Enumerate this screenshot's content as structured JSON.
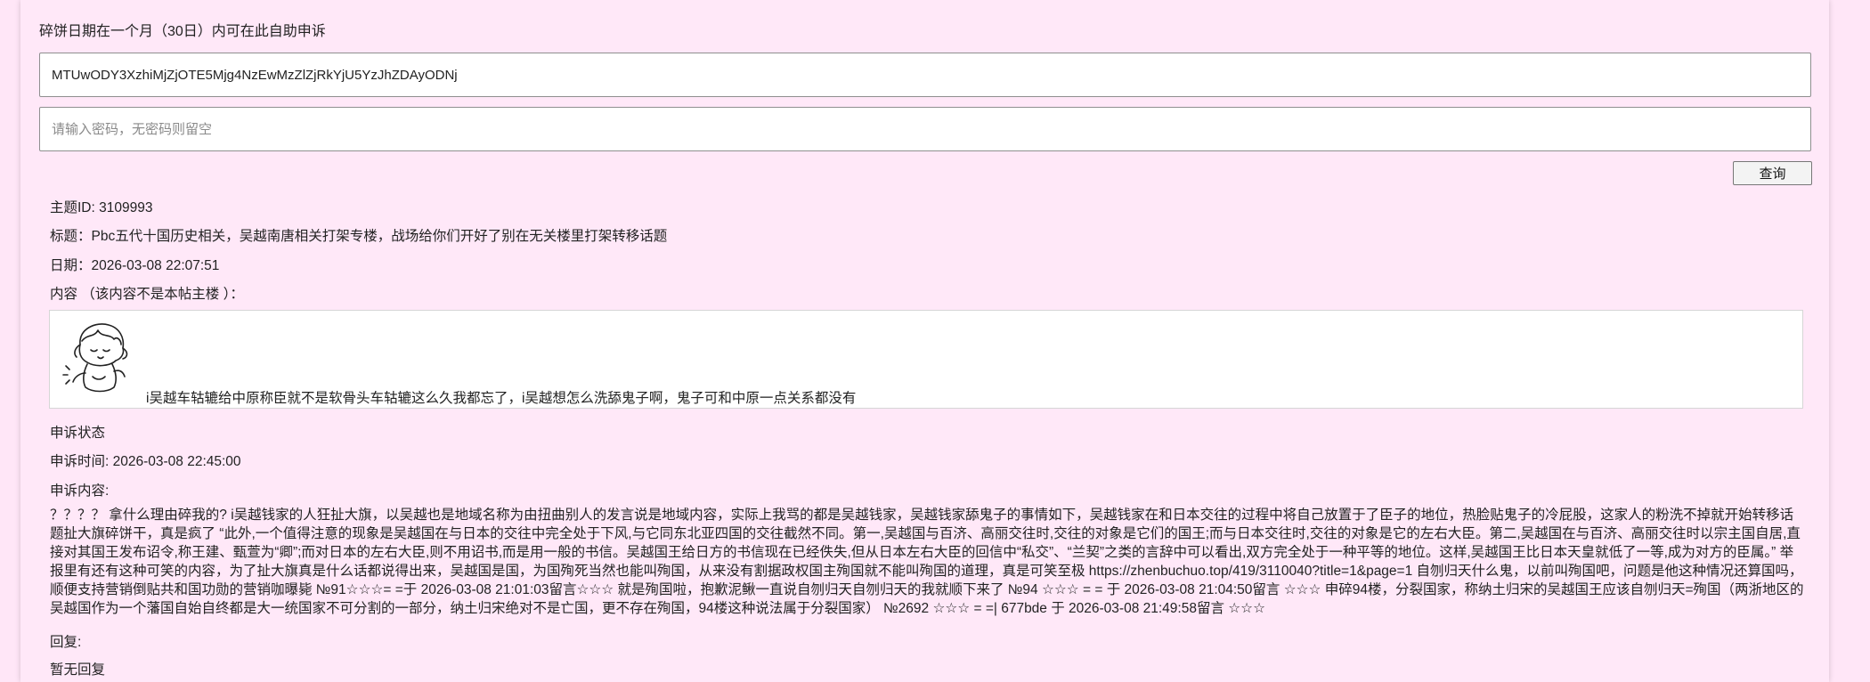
{
  "form": {
    "hint": "碎饼日期在一个月（30日）内可在此自助申诉",
    "token_value": "MTUwODY3XzhiMjZjOTE5Mjg4NzEwMzZlZjRkYjU5YzJhZDAyODNj",
    "password_placeholder": "请输入密码，无密码则留空",
    "query_button": "查询"
  },
  "topic": {
    "id_line": "主题ID: 3109993",
    "title_line": "标题：Pbc五代十国历史相关，吴越南唐相关打架专楼，战场给你们开好了别在无关楼里打架转移话题",
    "date_line": "日期：2026-03-08 22:07:51",
    "content_label": "内容 （该内容不是本帖主楼 ）：",
    "content_text": "i吴越车轱辘给中原称臣就不是软骨头车轱辘这么久我都忘了，i吴越想怎么洗舔鬼子啊，鬼子可和中原一点关系都没有",
    "sticker_icon": "cartoon-girl-sticker"
  },
  "appeal": {
    "status_label": "申诉状态",
    "time_line": "申诉时间: 2026-03-08 22:45:00",
    "content_label": "申诉内容:",
    "content_text": "？？？？ 拿什么理由碎我的? i吴越钱家的人狂扯大旗，以吴越也是地域名称为由扭曲别人的发言说是地域内容，实际上我骂的都是吴越钱家，吴越钱家舔鬼子的事情如下，吴越钱家在和日本交往的过程中将自己放置于了臣子的地位，热脸贴鬼子的冷屁股，这家人的粉洗不掉就开始转移话题扯大旗碎饼干，真是疯了 “此外,一个值得注意的现象是吴越国在与日本的交往中完全处于下风,与它同东北亚四国的交往截然不同。第一,吴越国与百济、高丽交往时,交往的对象是它们的国王;而与日本交往时,交往的对象是它的左右大臣。第二,吴越国在与百济、高丽交往时以宗主国自居,直接对其国王发布诏令,称王建、甄萱为“卿”;而对日本的左右大臣,则不用诏书,而是用一般的书信。吴越国王给日方的书信现在已经佚失,但从日本左右大臣的回信中“私交”、“兰契”之类的言辞中可以看出,双方完全处于一种平等的地位。这样,吴越国王比日本天皇就低了一等,成为对方的臣属。” 举报里有还有这种可笑的内容，为了扯大旗真是什么话都说得出来，吴越国是国，为国殉死当然也能叫殉国，从来没有割据政权国主殉国就不能叫殉国的道理，真是可笑至极 https://zhenbuchuo.top/419/3110040?title=1&page=1 自刎归天什么鬼，以前叫殉国吧，问题是他这种情况还算国吗，顺便支持营销倒贴共和国功勋的营销咖曝毙 №91☆☆☆= =于 2026-03-08 21:01:03留言☆☆☆ 就是殉国啦，抱歉泥鳅一直说自刎归天自刎归天的我就顺下来了 №94 ☆☆☆ = = 于 2026-03-08 21:04:50留言 ☆☆☆ 申碎94楼，分裂国家，称纳土归宋的吴越国王应该自刎归天=殉国（两浙地区的吴越国作为一个藩国自始自终都是大一统国家不可分割的一部分，纳土归宋绝对不是亡国，更不存在殉国，94楼这种说法属于分裂国家） №2692 ☆☆☆ = =| 677bde 于 2026-03-08 21:49:58留言 ☆☆☆",
    "reply_label": "回复:",
    "reply_text": "暂无回复"
  }
}
